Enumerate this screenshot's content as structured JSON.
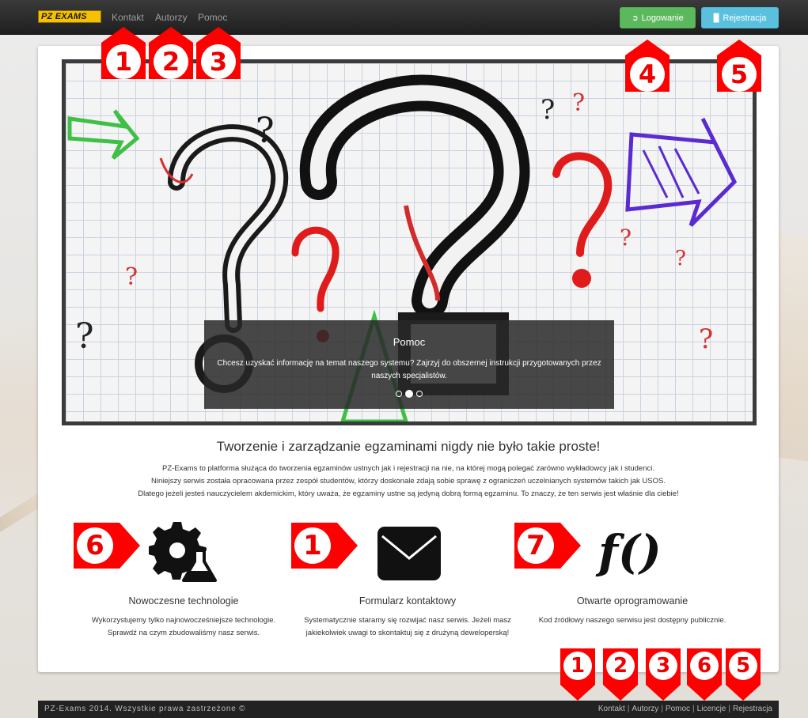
{
  "navbar": {
    "brand": "PZ EXAMS",
    "links": [
      "Kontakt",
      "Autorzy",
      "Pomoc"
    ],
    "login_label": "Logowanie",
    "register_label": "Rejestracja"
  },
  "carousel": {
    "caption_title": "Pomoc",
    "caption_text": "Chcesz uzyskać informację na temat naszego systemu? Zajrzyj do obszernej instrukcji przygotowanych przez naszych specjalistów.",
    "slide_count": 3,
    "active_slide": 2
  },
  "main": {
    "headline": "Tworzenie i zarządzanie egzaminami nigdy nie było takie proste!",
    "intro": [
      "PZ-Exams to platforma służąca do tworzenia egzaminów ustnych jak i rejestracji na nie, na której mogą polegać zarówno wykładowcy jak i studenci.",
      "Niniejszy serwis została opracowana przez zespół studentów, którzy doskonale zdają sobie sprawę z ograniczeń uczelnianych systemów takich jak USOS.",
      "Dlatego jeżeli jesteś nauczycielem akdemickim, który uważa, że egzaminy ustne są jedyną dobrą formą egzaminu. To znaczy, że ten serwis jest właśnie dla ciebie!"
    ]
  },
  "features": [
    {
      "title": "Nowoczesne technologie",
      "text": "Wykorzystujemy tylko najnowocześniejsze technologie. Sprawdź na czym zbudowaliśmy nasz serwis.",
      "icon": "gear-flask-icon"
    },
    {
      "title": "Formularz kontaktowy",
      "text": "Systematycznie staramy się rozwijać nasz serwis. Jeżeli masz jakiekolwiek uwagi to skontaktuj się z drużyną deweloperską!",
      "icon": "envelope-icon"
    },
    {
      "title": "Otwarte oprogramowanie",
      "text": "Kod źródłowy naszego serwisu jest dostępny publicznie.",
      "icon": "function-icon",
      "icon_text": "f()"
    }
  ],
  "footer": {
    "copyright": "PZ-Exams 2014. Wszystkie prawa zastrzeżone ©",
    "links": [
      "Kontakt",
      "Autorzy",
      "Pomoc",
      "Licencje",
      "Rejestracja"
    ]
  },
  "annotations": {
    "nav_markers": [
      "1",
      "2",
      "3",
      "4",
      "5"
    ],
    "feature_markers": [
      "6",
      "1",
      "7"
    ],
    "footer_markers": [
      "1",
      "2",
      "3",
      "6",
      "5"
    ],
    "marker_color": "#ff0000"
  },
  "colors": {
    "success": "#5cb85c",
    "info": "#5bc0de",
    "brand": "#f6c100",
    "navbar": "#222222"
  }
}
